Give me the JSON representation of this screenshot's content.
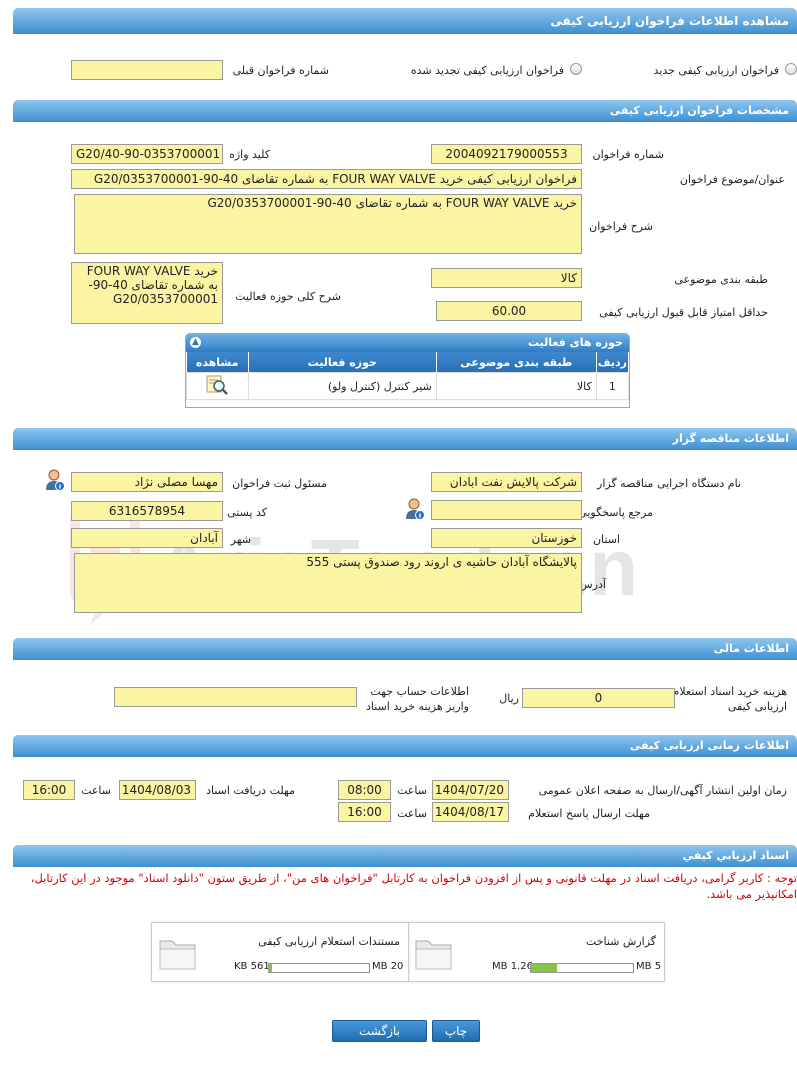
{
  "page_title": "مشاهده اطلاعات فراخوان ارزیابی کیفی",
  "call_type": {
    "option_new": "فراخوان ارزیابی کیفی جدید",
    "option_renewed": "فراخوان ارزیابی کیفی تجدید شده",
    "prev_call_label": "شماره فراخوان قبلی",
    "prev_call_value": ""
  },
  "specs": {
    "title": "مشخصات فراخوان ارزیابی کیفی",
    "call_number_label": "شماره فراخوان",
    "call_number": "2004092179000553",
    "keyword_label": "کلید واژه",
    "keyword": "G20/40-90-0353700001",
    "subject_label": "عنوان/موضوع فراخوان",
    "subject": "فراخوان ارزیابی کیفی خرید FOUR WAY VALVE  به شماره تقاضای 40-90-G20/0353700001",
    "description_label": "شرح فراخوان",
    "description": "خرید FOUR WAY VALVE  به شماره تقاضای 40-90-G20/0353700001",
    "category_label": "طبقه بندی موضوعی",
    "category": "کالا",
    "scope_label": "شرح کلی حوزه فعالیت",
    "scope": "خرید FOUR WAY VALVE  به شماره تقاضای 40-90-G20/0353700001",
    "min_score_label": "حداقل امتیاز قابل قبول ارزیابی کیفی",
    "min_score": "60.00"
  },
  "activity": {
    "title": "حوزه های فعالیت",
    "columns": [
      "ردیف",
      "طبقه بندی موضوعی",
      "حوزه فعالیت",
      "مشاهده"
    ],
    "rows": [
      {
        "index": "1",
        "category": "کالا",
        "field": "شیر کنترل (کنترل ولو)"
      }
    ]
  },
  "organizer": {
    "title": "اطلاعات مناقصه گزار",
    "org_label": "نام دستگاه اجرایی مناقصه گزار",
    "org": "شرکت پالایش نفت ابادان",
    "registrar_label": "مسئول ثبت فراخوان",
    "registrar": "مهسا مصلی نژاد",
    "ref_label": "مرجع پاسخگویی",
    "ref": "",
    "postal_label": "کد پستی",
    "postal": "6316578954",
    "province_label": "استان",
    "province": "خوزستان",
    "city_label": "شهر",
    "city": "آبادان",
    "address_label": "آدرس",
    "address": "پالایشگاه آبادان حاشیه ی اروند رود صندوق پستی 555"
  },
  "financial": {
    "title": "اطلاعات مالی",
    "cost_label": "هزینه خرید اسناد استعلام ارزیابی کیفی",
    "cost": "0",
    "currency": "ریال",
    "account_label": "اطلاعات حساب جهت واریز هزینه خرید اسناد",
    "account": ""
  },
  "timing": {
    "title": "اطلاعات زمانی ارزیابی کیفی",
    "publish_label": "زمان اولین انتشار آگهی/ارسال به صفحه اعلان عمومی",
    "publish_date": "1404/07/20",
    "time_label": "ساعت",
    "publish_time": "08:00",
    "receive_label": "مهلت دریافت اسناد",
    "receive_date": "1404/08/03",
    "receive_time": "16:00",
    "response_label": "مهلت ارسال پاسخ استعلام",
    "response_date": "1404/08/17",
    "response_time": "16:00"
  },
  "documents": {
    "title": "اسناد ارزيابي كيفي",
    "note": "توجه : کاربر گرامی، دریافت اسناد در مهلت قانونی و پس از افزودن فراخوان به کارتابل \"فراخوان های من\"، از طریق ستون \"دانلود اسناد\" موجود در این کارتابل، امکانپذیر می باشد.",
    "files": [
      {
        "name": "گزارش شناخت",
        "used": "1.26 MB",
        "max": "5 MB",
        "fill": 0.25
      },
      {
        "name": "مستندات استعلام ارزیابی کیفی",
        "used": "561 KB",
        "max": "20 MB",
        "fill": 0.03
      }
    ]
  },
  "buttons": {
    "print": "چاپ",
    "back": "بازگشت"
  },
  "watermark": "AriaTender.neT",
  "colors": {
    "header_blue": "#3d8fd1",
    "field_yellow": "#fbf4a3",
    "note_red": "#d40000",
    "progress_green": "#8bc34a"
  }
}
